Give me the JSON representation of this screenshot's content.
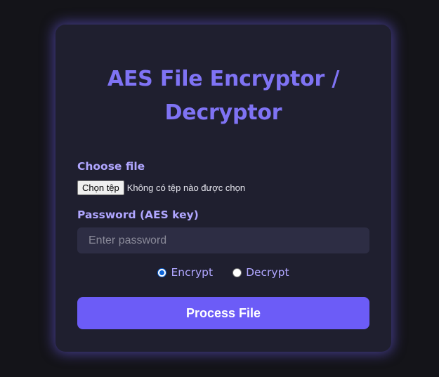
{
  "app": {
    "title": "AES File Encryptor / Decryptor"
  },
  "form": {
    "file_label": "Choose file",
    "file_button_label": "Chọn tệp",
    "file_status": "Không có tệp nào được chọn",
    "password_label": "Password (AES key)",
    "password_placeholder": "Enter password",
    "password_value": "",
    "modes": [
      {
        "label": "Encrypt",
        "selected": true
      },
      {
        "label": "Decrypt",
        "selected": false
      }
    ],
    "submit_label": "Process File"
  },
  "colors": {
    "background": "#141419",
    "card": "#1f1f2f",
    "accent": "#6c5cf7",
    "title": "#7f73f4",
    "label": "#b0a6ff",
    "input_bg": "#2d2d44"
  },
  "icons": {
    "encrypt_radio": "radio-checked-icon",
    "decrypt_radio": "radio-unchecked-icon"
  }
}
